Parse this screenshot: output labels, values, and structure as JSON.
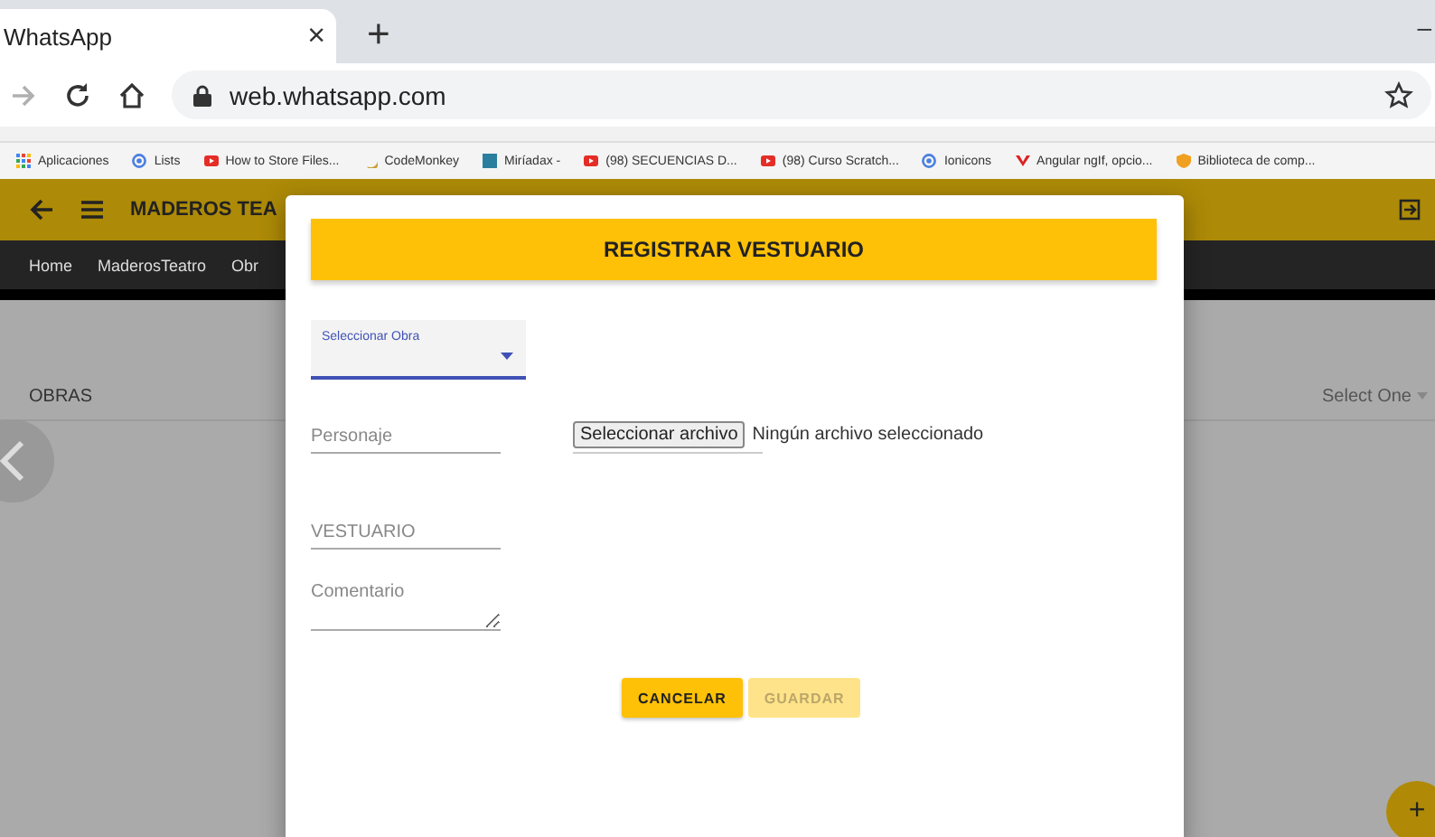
{
  "browser": {
    "tab": {
      "title": "WhatsApp",
      "close": "×"
    },
    "new_tab": "+",
    "minimize": "–",
    "url": "web.whatsapp.com"
  },
  "bookmarks": [
    {
      "kind": "apps",
      "label": "Aplicaciones"
    },
    {
      "kind": "globe",
      "label": "Lists"
    },
    {
      "kind": "video",
      "label": "How to Store Files..."
    },
    {
      "kind": "moon",
      "label": "CodeMonkey"
    },
    {
      "kind": "square",
      "label": "Miríadax -"
    },
    {
      "kind": "video",
      "label": "(98) SECUENCIAS D..."
    },
    {
      "kind": "video",
      "label": "(98) Curso Scratch..."
    },
    {
      "kind": "globe",
      "label": "Ionicons"
    },
    {
      "kind": "letter",
      "label": "Angular ngIf, opcio..."
    },
    {
      "kind": "shield",
      "label": "Biblioteca de comp..."
    }
  ],
  "app": {
    "title": "MADEROS TEA",
    "nav": [
      "Home",
      "MaderosTeatro",
      "Obr"
    ],
    "section": "OBRAS",
    "filter": "Select One",
    "fab": "+"
  },
  "dialog": {
    "title": "REGISTRAR VESTUARIO",
    "select_label": "Seleccionar Obra",
    "fields": [
      {
        "kind": "text",
        "placeholder": "Personaje"
      },
      {
        "kind": "text",
        "placeholder": "VESTUARIO"
      },
      {
        "kind": "textarea",
        "placeholder": "Comentario"
      }
    ],
    "file": {
      "button": "Seleccionar archivo",
      "status": "Ningún archivo seleccionado"
    },
    "buttons": [
      {
        "label": "CANCELAR",
        "disabled": false
      },
      {
        "label": "GUARDAR",
        "disabled": true
      }
    ]
  }
}
